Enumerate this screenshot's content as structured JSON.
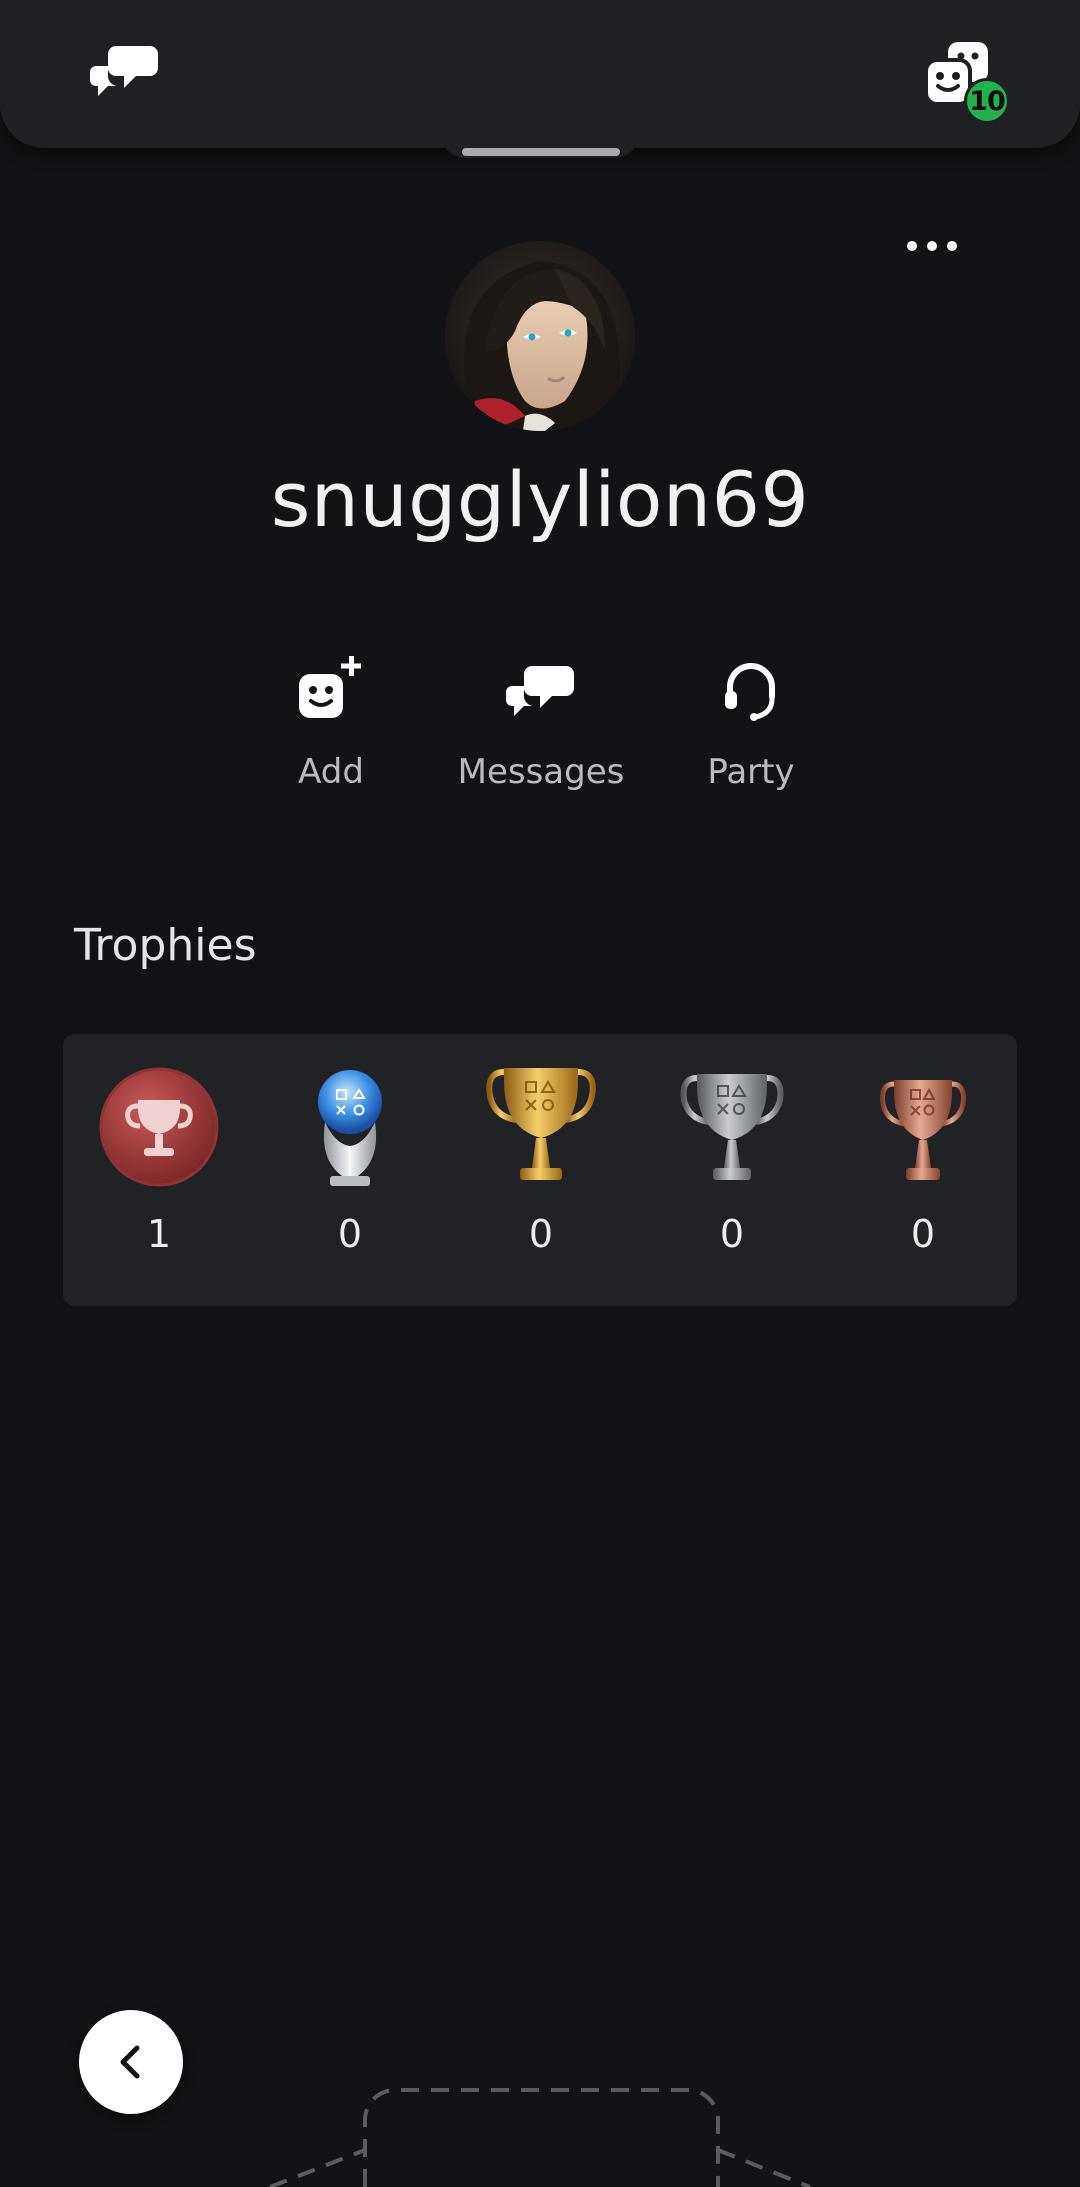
{
  "topbar": {
    "messages_icon": "chat-bubbles-icon",
    "friends_icon": "friends-faces-icon",
    "friends_badge": "10",
    "badge_color": "#22b14c"
  },
  "profile": {
    "username": "snugglylion69",
    "more_icon": "ellipsis-icon"
  },
  "actions": [
    {
      "label": "Add",
      "icon": "add-friend-icon"
    },
    {
      "label": "Messages",
      "icon": "chat-bubbles-icon"
    },
    {
      "label": "Party",
      "icon": "headset-icon"
    }
  ],
  "trophies": {
    "title": "Trophies",
    "items": [
      {
        "type": "trophy-level",
        "count": "1"
      },
      {
        "type": "platinum",
        "count": "0"
      },
      {
        "type": "gold",
        "count": "0"
      },
      {
        "type": "silver",
        "count": "0"
      },
      {
        "type": "bronze",
        "count": "0"
      }
    ]
  },
  "navigation": {
    "back_icon": "chevron-left-icon"
  },
  "colors": {
    "background": "#121316",
    "card": "#212226",
    "topbar": "#1e2024"
  }
}
